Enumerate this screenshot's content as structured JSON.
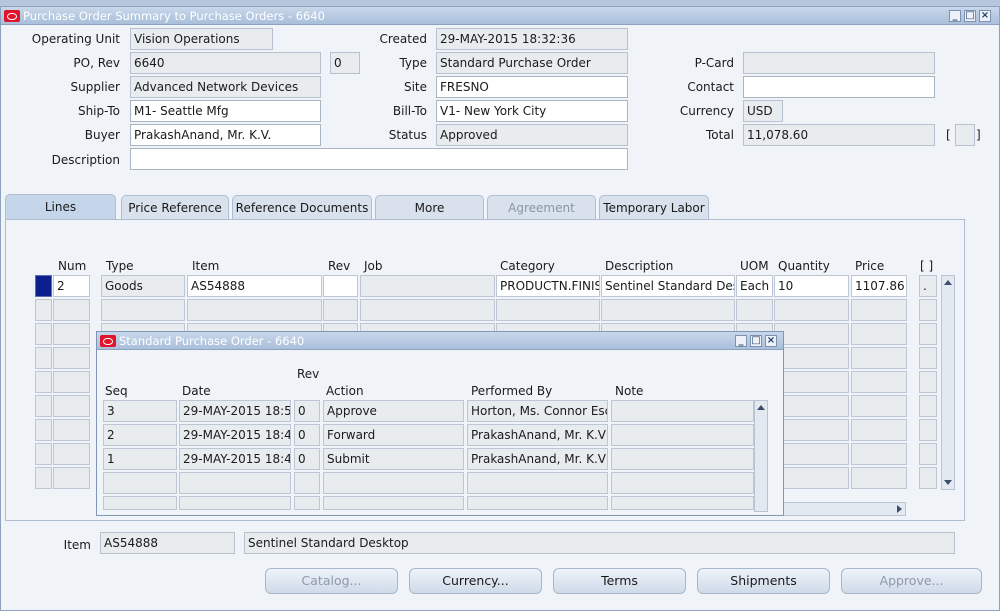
{
  "window": {
    "title": "Purchase Order Summary to Purchase Orders - 6640"
  },
  "header": {
    "operating_unit_label": "Operating Unit",
    "operating_unit": "Vision Operations",
    "po_rev_label": "PO, Rev",
    "po": "6640",
    "rev": "0",
    "supplier_label": "Supplier",
    "supplier": "Advanced Network Devices",
    "ship_to_label": "Ship-To",
    "ship_to": "M1- Seattle Mfg",
    "buyer_label": "Buyer",
    "buyer": "PrakashAnand, Mr. K.V.",
    "description_label": "Description",
    "description": "",
    "created_label": "Created",
    "created": "29-MAY-2015 18:32:36",
    "type_label": "Type",
    "type": "Standard Purchase Order",
    "site_label": "Site",
    "site": "FRESNO",
    "bill_to_label": "Bill-To",
    "bill_to": "V1- New York City",
    "status_label": "Status",
    "status": "Approved",
    "pcard_label": "P-Card",
    "pcard": "",
    "contact_label": "Contact",
    "contact": "",
    "currency_label": "Currency",
    "currency": "USD",
    "total_label": "Total",
    "total": "11,078.60",
    "bracket_left": "[",
    "bracket_right": "]"
  },
  "tabs": [
    {
      "label": "Lines"
    },
    {
      "label": "Price Reference"
    },
    {
      "label": "Reference Documents"
    },
    {
      "label": "More"
    },
    {
      "label": "Agreement"
    },
    {
      "label": "Temporary Labor"
    }
  ],
  "lines": {
    "columns": {
      "num": "Num",
      "type": "Type",
      "item": "Item",
      "rev": "Rev",
      "job": "Job",
      "category": "Category",
      "description": "Description",
      "uom": "UOM",
      "quantity": "Quantity",
      "price": "Price",
      "flex": "[ ]"
    },
    "rows": [
      {
        "num": "2",
        "type": "Goods",
        "item": "AS54888",
        "rev": "",
        "job": "",
        "category": "PRODUCTN.FINISHED",
        "description": "Sentinel Standard Desktop",
        "uom": "Each",
        "quantity": "10",
        "price": "1107.86",
        "flex": "."
      }
    ]
  },
  "dialog": {
    "title": "Standard Purchase Order - 6640",
    "columns": {
      "seq": "Seq",
      "date": "Date",
      "rev": "Rev",
      "action": "Action",
      "performed_by": "Performed By",
      "note": "Note"
    },
    "rows": [
      {
        "seq": "3",
        "date": "29-MAY-2015 18:5",
        "rev": "0",
        "action": "Approve",
        "performed_by": "Horton, Ms. Connor Esc",
        "note": ""
      },
      {
        "seq": "2",
        "date": "29-MAY-2015 18:4",
        "rev": "0",
        "action": "Forward",
        "performed_by": "PrakashAnand, Mr. K.V",
        "note": ""
      },
      {
        "seq": "1",
        "date": "29-MAY-2015 18:4",
        "rev": "0",
        "action": "Submit",
        "performed_by": "PrakashAnand, Mr. K.V",
        "note": ""
      }
    ]
  },
  "footer": {
    "item_label": "Item",
    "item": "AS54888",
    "item_description": "Sentinel Standard Desktop"
  },
  "buttons": {
    "catalog": "Catalog...",
    "currency": "Currency...",
    "terms": "Terms",
    "shipments": "Shipments",
    "approve": "Approve..."
  }
}
